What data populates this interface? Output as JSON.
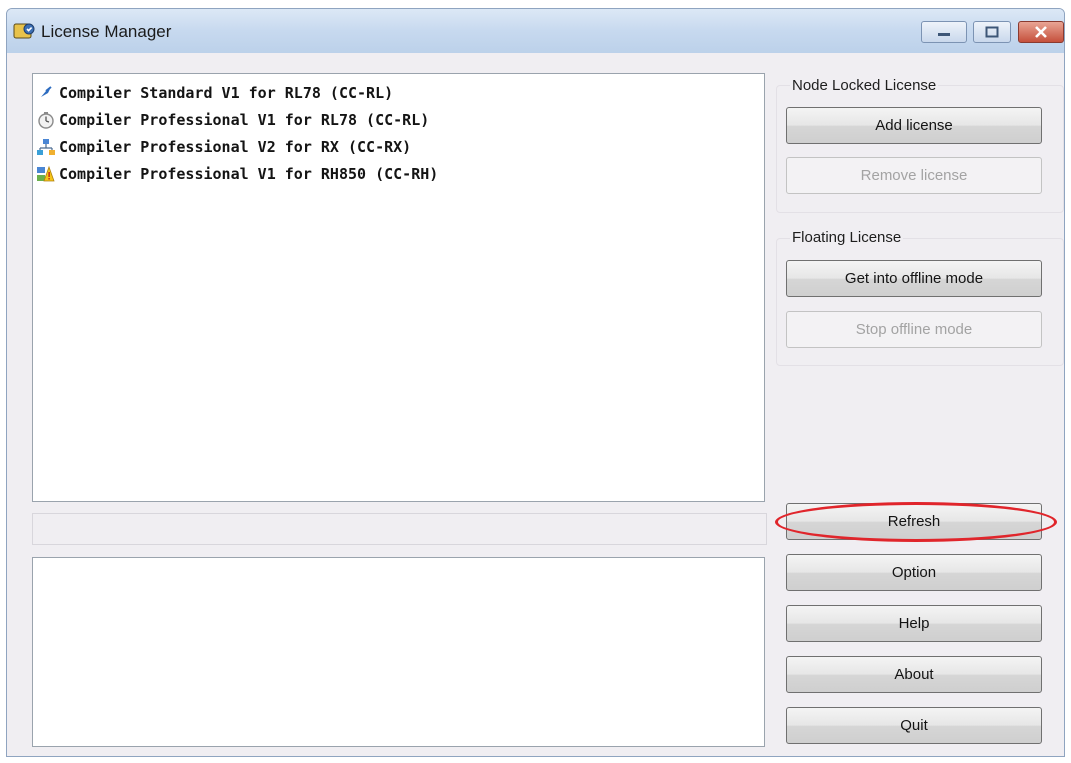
{
  "window": {
    "title": "License Manager",
    "icon": "license-manager-app-icon"
  },
  "title_bar_buttons": {
    "minimize_icon": "minimize-icon",
    "maximize_icon": "maximize-icon",
    "close_icon": "close-icon"
  },
  "licenses": [
    {
      "label": "Compiler Standard V1 for RL78 (CC-RL)",
      "icon": "checkmark-pin-icon"
    },
    {
      "label": "Compiler Professional V1 for RL78 (CC-RL)",
      "icon": "clock-icon"
    },
    {
      "label": "Compiler Professional V2 for RX (CC-RX)",
      "icon": "network-icon"
    },
    {
      "label": "Compiler Professional V1 for RH850 (CC-RH)",
      "icon": "warning-icon"
    }
  ],
  "node_locked": {
    "group_label": "Node Locked License",
    "add_label": "Add license",
    "remove_label": "Remove license"
  },
  "floating": {
    "group_label": "Floating License",
    "offline_label": "Get into offline mode",
    "stop_offline_label": "Stop offline mode"
  },
  "actions": {
    "refresh_label": "Refresh",
    "option_label": "Option",
    "help_label": "Help",
    "about_label": "About",
    "quit_label": "Quit"
  },
  "colors": {
    "highlight": "#e0252b",
    "title_bar": "#c7d9ef",
    "window_bg": "#f0eef2"
  }
}
